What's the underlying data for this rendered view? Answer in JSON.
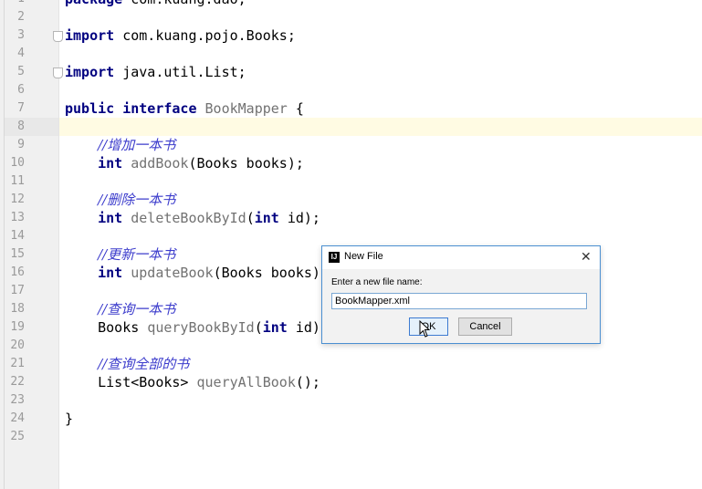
{
  "editor": {
    "line_numbers": [
      "1",
      "2",
      "3",
      "4",
      "5",
      "6",
      "7",
      "8",
      "9",
      "10",
      "11",
      "12",
      "13",
      "14",
      "15",
      "16",
      "17",
      "18",
      "19",
      "20",
      "21",
      "22",
      "23",
      "24",
      "25"
    ],
    "lines": [
      {
        "n": 1,
        "segments": [
          {
            "t": "package ",
            "c": "kw"
          },
          {
            "t": "com.kuang.dao;",
            "c": "ident"
          }
        ]
      },
      {
        "n": 3,
        "segments": [
          {
            "t": "import ",
            "c": "kw"
          },
          {
            "t": "com.kuang.pojo.Books;",
            "c": "ident"
          }
        ]
      },
      {
        "n": 5,
        "segments": [
          {
            "t": "import ",
            "c": "kw"
          },
          {
            "t": "java.util.List;",
            "c": "ident"
          }
        ]
      },
      {
        "n": 7,
        "segments": [
          {
            "t": "public interface ",
            "c": "kw"
          },
          {
            "t": "BookMapper",
            "c": "iface"
          },
          {
            "t": " {",
            "c": "ident"
          }
        ]
      },
      {
        "n": 9,
        "segments": [
          {
            "t": "    ",
            "c": "ident"
          },
          {
            "t": "//增加一本书",
            "c": "comment"
          }
        ]
      },
      {
        "n": 10,
        "segments": [
          {
            "t": "    ",
            "c": "ident"
          },
          {
            "t": "int ",
            "c": "kw"
          },
          {
            "t": "addBook",
            "c": "iface"
          },
          {
            "t": "(Books books);",
            "c": "ident"
          }
        ]
      },
      {
        "n": 12,
        "segments": [
          {
            "t": "    ",
            "c": "ident"
          },
          {
            "t": "//删除一本书",
            "c": "comment"
          }
        ]
      },
      {
        "n": 13,
        "segments": [
          {
            "t": "    ",
            "c": "ident"
          },
          {
            "t": "int ",
            "c": "kw"
          },
          {
            "t": "deleteBookById",
            "c": "iface"
          },
          {
            "t": "(",
            "c": "ident"
          },
          {
            "t": "int ",
            "c": "kw"
          },
          {
            "t": "id);",
            "c": "ident"
          }
        ]
      },
      {
        "n": 15,
        "segments": [
          {
            "t": "    ",
            "c": "ident"
          },
          {
            "t": "//更新一本书",
            "c": "comment"
          }
        ]
      },
      {
        "n": 16,
        "segments": [
          {
            "t": "    ",
            "c": "ident"
          },
          {
            "t": "int ",
            "c": "kw"
          },
          {
            "t": "updateBook",
            "c": "iface"
          },
          {
            "t": "(Books books)",
            "c": "ident"
          }
        ]
      },
      {
        "n": 18,
        "segments": [
          {
            "t": "    ",
            "c": "ident"
          },
          {
            "t": "//查询一本书",
            "c": "comment"
          }
        ]
      },
      {
        "n": 19,
        "segments": [
          {
            "t": "    ",
            "c": "ident"
          },
          {
            "t": "Books ",
            "c": "ident"
          },
          {
            "t": "queryBookById",
            "c": "iface"
          },
          {
            "t": "(",
            "c": "ident"
          },
          {
            "t": "int ",
            "c": "kw"
          },
          {
            "t": "id)",
            "c": "ident"
          }
        ]
      },
      {
        "n": 21,
        "segments": [
          {
            "t": "    ",
            "c": "ident"
          },
          {
            "t": "//查询全部的书",
            "c": "comment"
          }
        ]
      },
      {
        "n": 22,
        "segments": [
          {
            "t": "    ",
            "c": "ident"
          },
          {
            "t": "List<Books> ",
            "c": "ident"
          },
          {
            "t": "queryAllBook",
            "c": "iface"
          },
          {
            "t": "();",
            "c": "ident"
          }
        ]
      },
      {
        "n": 24,
        "segments": [
          {
            "t": "}",
            "c": "ident"
          }
        ]
      }
    ],
    "current_line": 8
  },
  "dialog": {
    "title": "New File",
    "app_icon": "intellij-icon",
    "prompt": "Enter a new file name:",
    "file_name_value": "BookMapper.xml",
    "ok_label": "OK",
    "cancel_label": "Cancel",
    "close_glyph": "✕"
  },
  "colors": {
    "keyword": "#000080",
    "comment": "#3c3ccc",
    "method": "#727272",
    "current_line": "#fffbe3",
    "dialog_border": "#4a8fd1"
  }
}
